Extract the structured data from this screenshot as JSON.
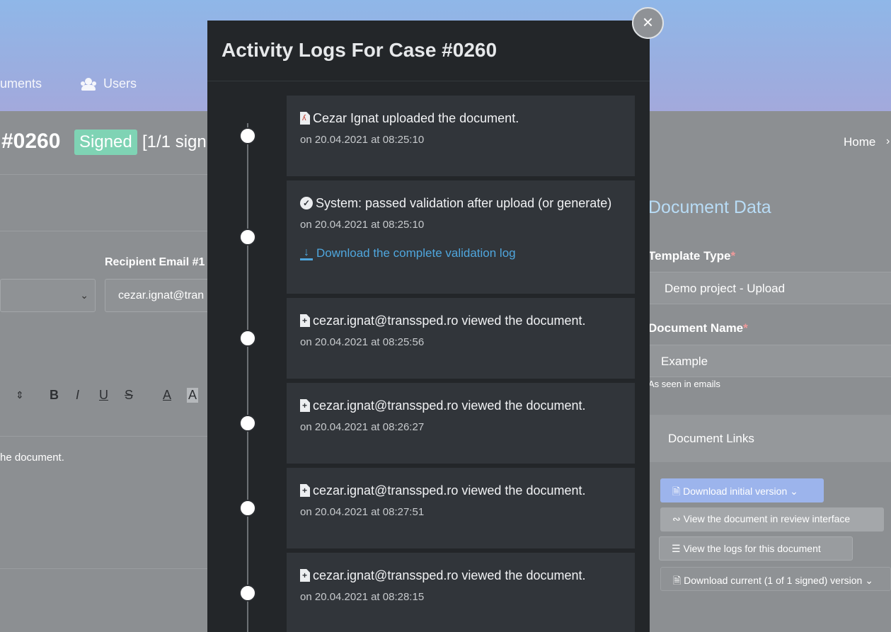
{
  "background": {
    "nav": {
      "documents": "uments",
      "users": "Users"
    },
    "title": "#0260",
    "badge": "Signed",
    "signed_count": "[1/1 sign",
    "breadcrumb_home": "Home",
    "breadcrumb_sep": "›",
    "recipient_label": "Recipient Email #1",
    "recipient_value": "cezar.ignat@tran",
    "editor_text": "he document.",
    "toolbar": {
      "bold": "B",
      "italic": "I",
      "underline": "U",
      "strike": "S",
      "color": "A",
      "highlight": "A"
    },
    "right_panel": {
      "title": "Document Data",
      "template_label": "Template Type",
      "template_value": "Demo project - Upload",
      "name_label": "Document Name",
      "name_value": "Example",
      "name_note": "As seen in emails",
      "required": "*",
      "links_title": "Document Links",
      "btn_initial": "Download initial version",
      "btn_review": "View the document in review interface",
      "btn_logs": "View the logs for this document",
      "btn_current": "Download current (1 of 1 signed) version"
    }
  },
  "modal": {
    "title": "Activity Logs For Case #0260",
    "close": "×",
    "entries": [
      {
        "icon": "pdf-file-icon",
        "text": "Cezar Ignat uploaded the document.",
        "date": "on 20.04.2021 at 08:25:10"
      },
      {
        "icon": "check-circle-icon",
        "text": "System: passed validation after upload (or generate)",
        "date": "on 20.04.2021 at 08:25:10",
        "link": "Download the complete validation log"
      },
      {
        "icon": "file-plus-icon",
        "text": "cezar.ignat@transsped.ro viewed the document.",
        "date": "on 20.04.2021 at 08:25:56"
      },
      {
        "icon": "file-plus-icon",
        "text": "cezar.ignat@transsped.ro viewed the document.",
        "date": "on 20.04.2021 at 08:26:27"
      },
      {
        "icon": "file-plus-icon",
        "text": "cezar.ignat@transsped.ro viewed the document.",
        "date": "on 20.04.2021 at 08:27:51"
      },
      {
        "icon": "file-plus-icon",
        "text": "cezar.ignat@transsped.ro viewed the document.",
        "date": "on 20.04.2021 at 08:28:15"
      }
    ]
  }
}
